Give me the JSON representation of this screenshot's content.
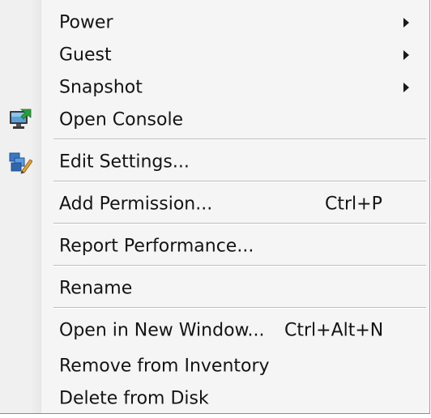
{
  "menu": {
    "items": [
      {
        "label": "Power",
        "shortcut": "",
        "icon": "",
        "submenu": true
      },
      {
        "label": "Guest",
        "shortcut": "",
        "icon": "",
        "submenu": true
      },
      {
        "label": "Snapshot",
        "shortcut": "",
        "icon": "",
        "submenu": true
      },
      {
        "label": "Open Console",
        "shortcut": "",
        "icon": "monitor-console-icon",
        "submenu": false
      },
      {
        "label": "Edit Settings...",
        "shortcut": "",
        "icon": "edit-settings-icon",
        "submenu": false
      },
      {
        "label": "Add Permission...",
        "shortcut": "Ctrl+P",
        "icon": "",
        "submenu": false
      },
      {
        "label": "Report Performance...",
        "shortcut": "",
        "icon": "",
        "submenu": false
      },
      {
        "label": "Rename",
        "shortcut": "",
        "icon": "",
        "submenu": false
      },
      {
        "label": "Open in New Window...",
        "shortcut": "Ctrl+Alt+N",
        "icon": "",
        "submenu": false
      },
      {
        "label": "Remove from Inventory",
        "shortcut": "",
        "icon": "",
        "submenu": false
      },
      {
        "label": "Delete from Disk",
        "shortcut": "",
        "icon": "",
        "submenu": false
      }
    ]
  },
  "colors": {
    "background": "#f5f5f5",
    "text": "#141414",
    "separator": "#bdbdbd"
  }
}
